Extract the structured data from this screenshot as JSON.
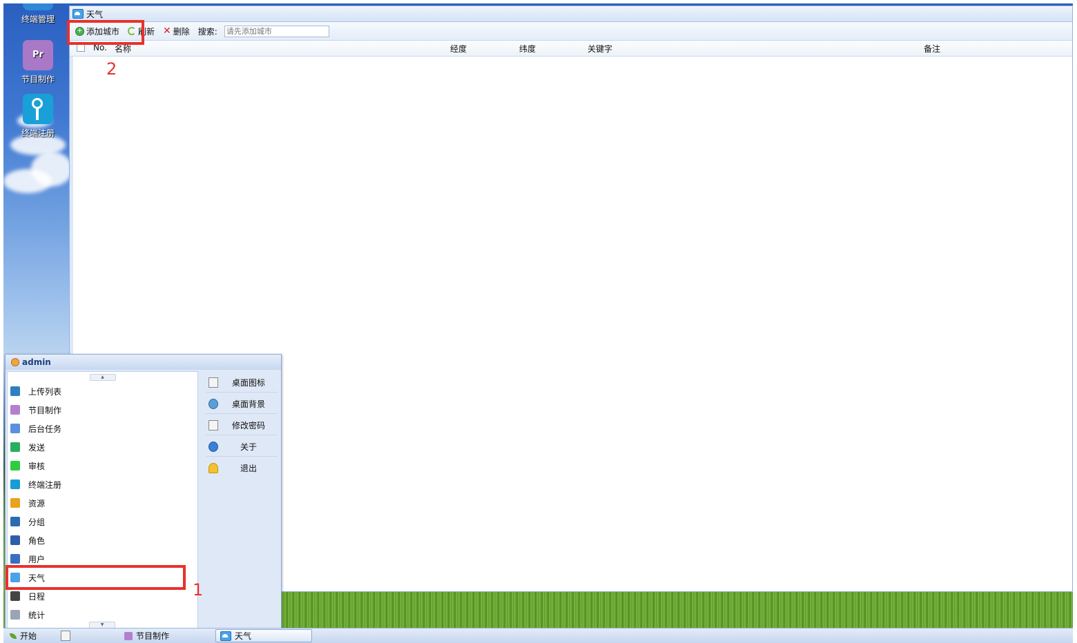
{
  "desktop": {
    "icons": [
      {
        "label": "终端管理"
      },
      {
        "label": "节目制作",
        "icon_text": "Pr"
      },
      {
        "label": "终端注册"
      }
    ]
  },
  "window": {
    "title": "天气",
    "toolbar": {
      "add_label": "添加城市",
      "refresh_label": "刷新",
      "delete_label": "删除",
      "search_label": "搜索:",
      "search_placeholder": "请先添加城市"
    },
    "grid": {
      "columns": [
        "No.",
        "名称",
        "经度",
        "纬度",
        "关键字",
        "备注"
      ]
    }
  },
  "annotations": {
    "num1": "1",
    "num2": "2",
    "color": "#e8312c"
  },
  "start_menu": {
    "user": "admin",
    "items": [
      {
        "label": "上传列表",
        "icon": "upload-icon",
        "color": "#2d7fc1"
      },
      {
        "label": "节目制作",
        "icon": "program-icon",
        "color": "#b57fcf"
      },
      {
        "label": "后台任务",
        "icon": "task-icon",
        "color": "#5b8fe0"
      },
      {
        "label": "发送",
        "icon": "send-icon",
        "color": "#27ae60"
      },
      {
        "label": "审核",
        "icon": "check-icon",
        "color": "#2ecc40"
      },
      {
        "label": "终端注册",
        "icon": "key-icon",
        "color": "#1a9bd7"
      },
      {
        "label": "资源",
        "icon": "resource-icon",
        "color": "#e9a21a"
      },
      {
        "label": "分组",
        "icon": "group-icon",
        "color": "#2b6cb0"
      },
      {
        "label": "角色",
        "icon": "role-icon",
        "color": "#2d5fa8"
      },
      {
        "label": "用户",
        "icon": "user-icon",
        "color": "#3a6fbf"
      },
      {
        "label": "天气",
        "icon": "weather-icon",
        "color": "#4aa3e8"
      },
      {
        "label": "日程",
        "icon": "schedule-icon",
        "color": "#444444"
      },
      {
        "label": "统计",
        "icon": "stats-icon",
        "color": "#9aa5b3"
      }
    ],
    "right_items": [
      {
        "label": "桌面图标",
        "icon": "edit-icon"
      },
      {
        "label": "桌面背景",
        "icon": "gear-icon"
      },
      {
        "label": "修改密码",
        "icon": "edit-icon"
      },
      {
        "label": "关于",
        "icon": "info-icon"
      },
      {
        "label": "退出",
        "icon": "key-icon"
      }
    ]
  },
  "taskbar": {
    "start_label": "开始",
    "tasks": [
      {
        "label": ""
      },
      {
        "label": "节目制作"
      },
      {
        "label": "天气"
      }
    ]
  }
}
